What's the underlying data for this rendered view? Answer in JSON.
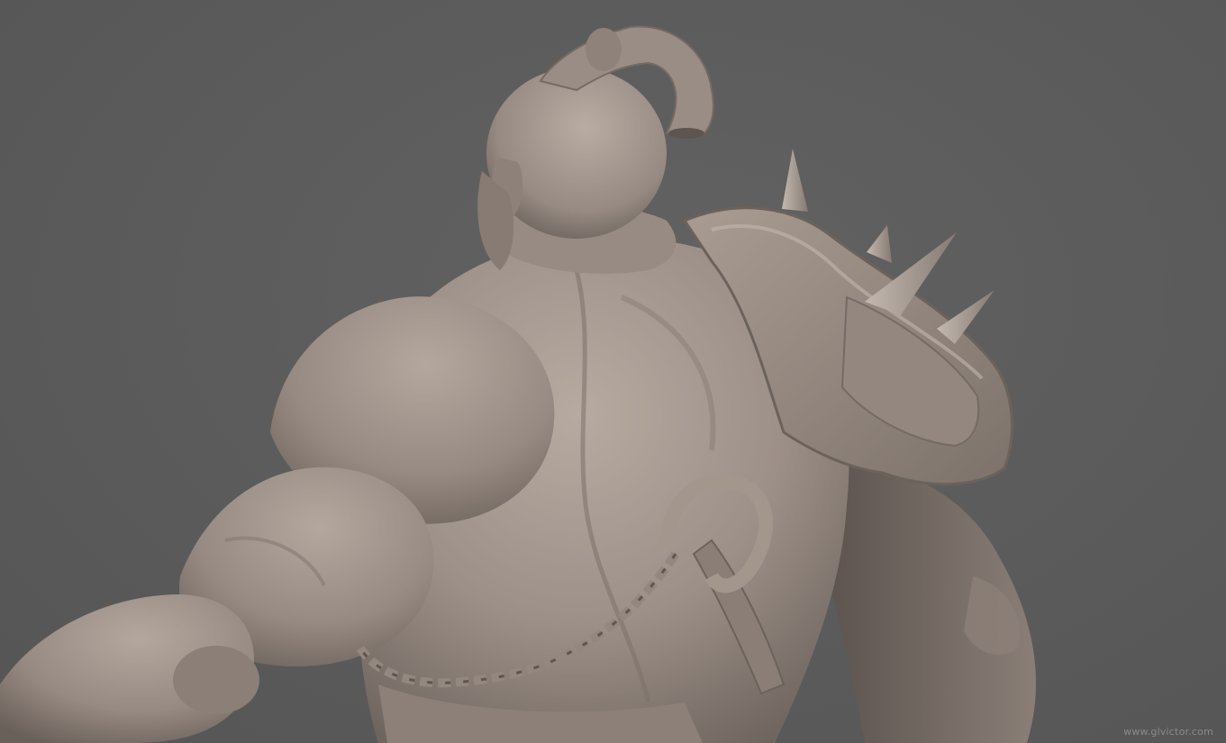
{
  "image": {
    "subject": "orc-sculpt-back-view",
    "background_color": "#5a5a5a",
    "clay_color": "#9c8f86",
    "watermark": "www.glvictor.com"
  }
}
